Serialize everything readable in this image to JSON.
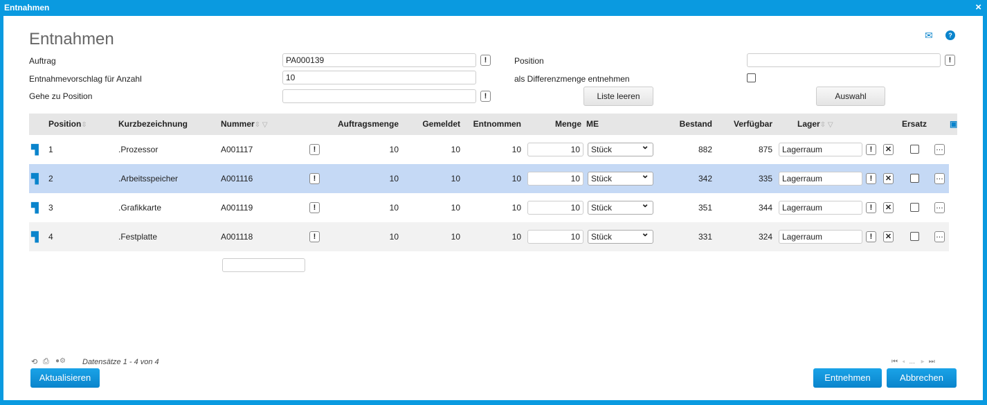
{
  "window": {
    "title": "Entnahmen",
    "close": "×"
  },
  "page_title": "Entnahmen",
  "form": {
    "auftrag_label": "Auftrag",
    "auftrag_value": "PA000139",
    "vorschlag_label": "Entnahmevorschlag für Anzahl",
    "vorschlag_value": "10",
    "gehe_label": "Gehe zu Position",
    "gehe_value": "",
    "position_label": "Position",
    "position_value": "",
    "differenz_label": "als Differenzmenge entnehmen",
    "liste_leeren": "Liste leeren",
    "auswahl": "Auswahl",
    "info": "!"
  },
  "table": {
    "headers": {
      "position": "Position",
      "kurz": "Kurzbezeichnung",
      "nummer": "Nummer",
      "auftragsmenge": "Auftragsmenge",
      "gemeldet": "Gemeldet",
      "entnommen": "Entnommen",
      "menge": "Menge",
      "me": "ME",
      "bestand": "Bestand",
      "verfuegbar": "Verfügbar",
      "lager": "Lager",
      "ersatz": "Ersatz"
    },
    "rows": [
      {
        "position": "1",
        "kurz": ".Prozessor",
        "nummer": "A001117",
        "auftragsmenge": "10",
        "gemeldet": "10",
        "entnommen": "10",
        "menge": "10",
        "me": "Stück",
        "bestand": "882",
        "verfuegbar": "875",
        "lager": "Lagerraum"
      },
      {
        "position": "2",
        "kurz": ".Arbeitsspeicher",
        "nummer": "A001116",
        "auftragsmenge": "10",
        "gemeldet": "10",
        "entnommen": "10",
        "menge": "10",
        "me": "Stück",
        "bestand": "342",
        "verfuegbar": "335",
        "lager": "Lagerraum"
      },
      {
        "position": "3",
        "kurz": ".Grafikkarte",
        "nummer": "A001119",
        "auftragsmenge": "10",
        "gemeldet": "10",
        "entnommen": "10",
        "menge": "10",
        "me": "Stück",
        "bestand": "351",
        "verfuegbar": "344",
        "lager": "Lagerraum"
      },
      {
        "position": "4",
        "kurz": ".Festplatte",
        "nummer": "A001118",
        "auftragsmenge": "10",
        "gemeldet": "10",
        "entnommen": "10",
        "menge": "10",
        "me": "Stück",
        "bestand": "331",
        "verfuegbar": "324",
        "lager": "Lagerraum"
      }
    ],
    "selected_row": 1
  },
  "footer": {
    "records": "Datensätze 1 - 4 von 4",
    "aktualisieren": "Aktualisieren",
    "entnehmen": "Entnehmen",
    "abbrechen": "Abbrechen",
    "pager_dots": "..."
  },
  "colors": {
    "accent": "#0a9ae0",
    "selected_row": "#c5d9f5",
    "header": "#e6e6e6"
  }
}
